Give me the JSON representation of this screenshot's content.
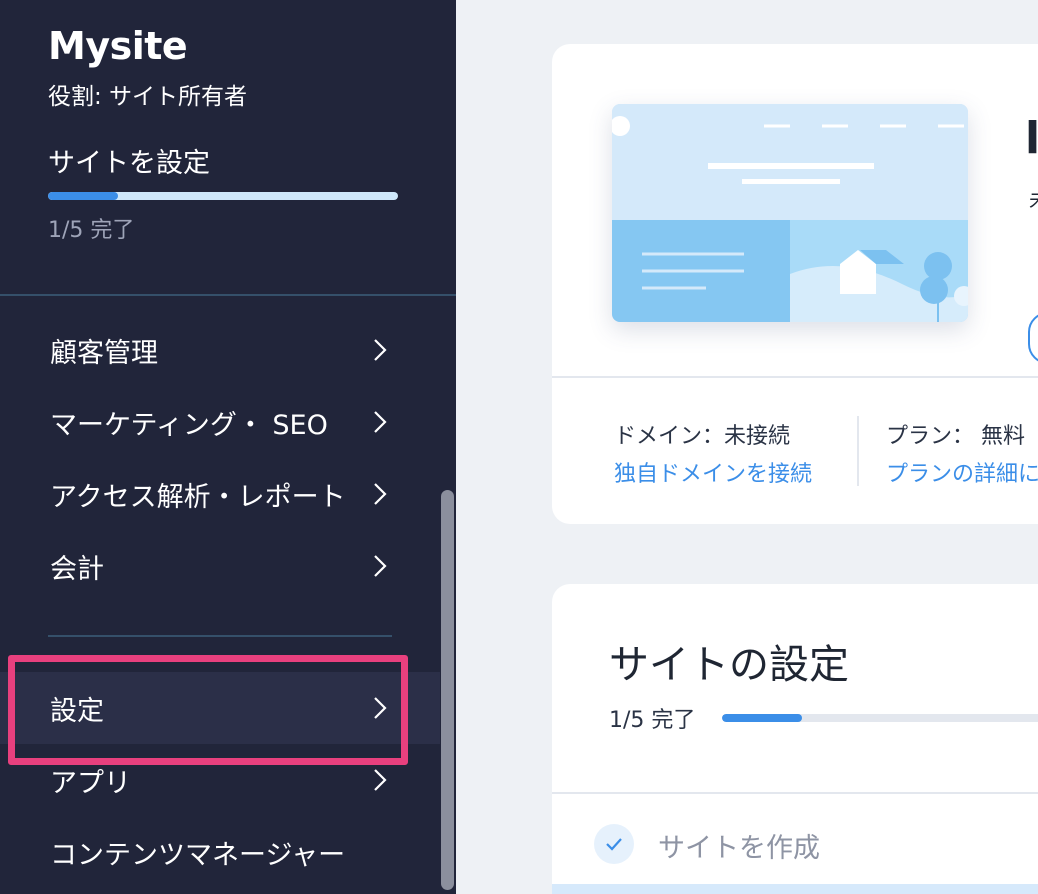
{
  "sidebar": {
    "site_name": "Mysite",
    "role": "役割: サイト所有者",
    "setup_title": "サイトを設定",
    "setup_progress_text": "1/5 完了",
    "setup_progress_fraction": 0.2,
    "nav": [
      {
        "label": "顧客管理"
      },
      {
        "label": "マーケティング・ SEO"
      },
      {
        "label": "アクセス解析・レポート"
      },
      {
        "label": "会計"
      },
      {
        "label": "設定"
      },
      {
        "label": "アプリ"
      },
      {
        "label": "コンテンツマネージャー"
      }
    ]
  },
  "site_card": {
    "domain_label": "ドメイン：未接続",
    "domain_link": "独自ドメインを接続",
    "plan_label": "プラン： 無料",
    "plan_link": "プランの詳細に"
  },
  "setup_card": {
    "title": "サイトの設定",
    "progress_text": "1/5 完了",
    "progress_fraction": 0.2,
    "tasks": [
      {
        "label": "サイトを作成",
        "done": true
      }
    ]
  },
  "colors": {
    "sidebar_bg": "#21253a",
    "accent": "#3b8ee8",
    "highlight": "#e8407e"
  }
}
